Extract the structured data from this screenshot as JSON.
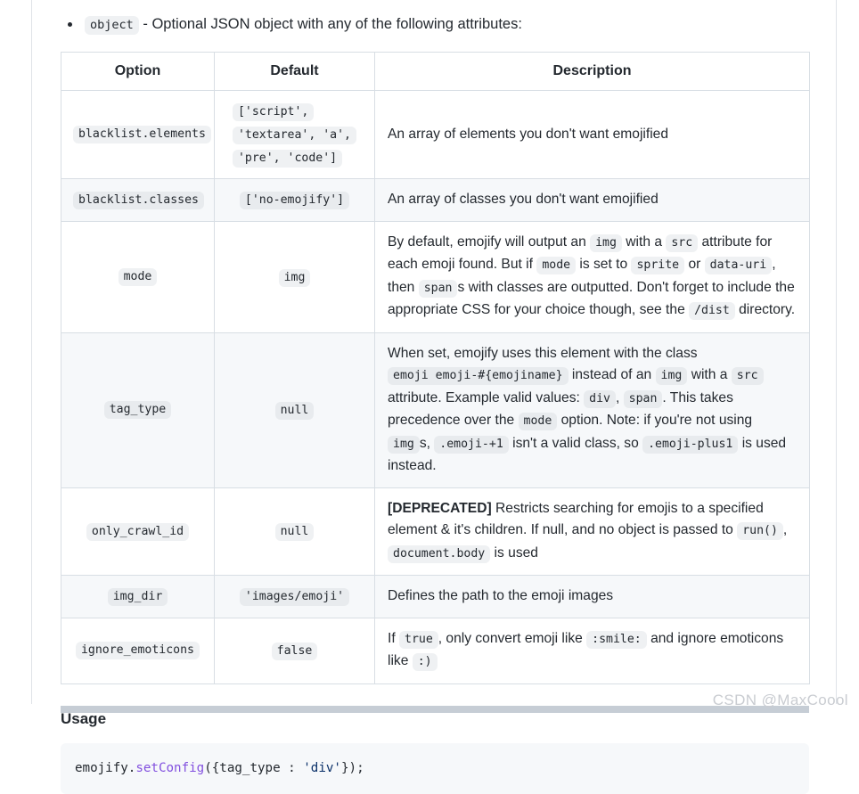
{
  "intro": {
    "code_chip": "object",
    "text": " - Optional JSON object with any of the following attributes:"
  },
  "table": {
    "headers": [
      "Option",
      "Default",
      "Description"
    ],
    "rows": [
      {
        "option": "blacklist.elements",
        "default_lines": [
          "['script',",
          "'textarea', 'a',",
          "'pre', 'code']"
        ],
        "description_parts": [
          {
            "type": "text",
            "value": "An array of elements you don't want emojified"
          }
        ]
      },
      {
        "option": "blacklist.classes",
        "default_lines": [
          "['no-emojify']"
        ],
        "description_parts": [
          {
            "type": "text",
            "value": "An array of classes you don't want emojified"
          }
        ]
      },
      {
        "option": "mode",
        "default_lines": [
          "img"
        ],
        "description_parts": [
          {
            "type": "text",
            "value": "By default, emojify will output an "
          },
          {
            "type": "code",
            "value": "img"
          },
          {
            "type": "text",
            "value": " with a "
          },
          {
            "type": "code",
            "value": "src"
          },
          {
            "type": "text",
            "value": " attribute for each emoji found. But if "
          },
          {
            "type": "code",
            "value": "mode"
          },
          {
            "type": "text",
            "value": " is set to "
          },
          {
            "type": "code",
            "value": "sprite"
          },
          {
            "type": "text",
            "value": " or "
          },
          {
            "type": "code",
            "value": "data-uri"
          },
          {
            "type": "text",
            "value": ", then "
          },
          {
            "type": "code",
            "value": "span"
          },
          {
            "type": "text",
            "value": "s with classes are outputted. Don't forget to include the appropriate CSS for your choice though, see the "
          },
          {
            "type": "code",
            "value": "/dist"
          },
          {
            "type": "text",
            "value": " directory."
          }
        ]
      },
      {
        "option": "tag_type",
        "default_lines": [
          "null"
        ],
        "description_parts": [
          {
            "type": "text",
            "value": "When set, emojify uses this element with the class "
          },
          {
            "type": "code",
            "value": "emoji emoji-#{emojiname}"
          },
          {
            "type": "text",
            "value": " instead of an "
          },
          {
            "type": "code",
            "value": "img"
          },
          {
            "type": "text",
            "value": " with a "
          },
          {
            "type": "code",
            "value": "src"
          },
          {
            "type": "text",
            "value": " attribute. Example valid values: "
          },
          {
            "type": "code",
            "value": "div"
          },
          {
            "type": "text",
            "value": ", "
          },
          {
            "type": "code",
            "value": "span"
          },
          {
            "type": "text",
            "value": ". This takes precedence over the "
          },
          {
            "type": "code",
            "value": "mode"
          },
          {
            "type": "text",
            "value": " option. Note: if you're not using "
          },
          {
            "type": "code",
            "value": "img"
          },
          {
            "type": "text",
            "value": "s, "
          },
          {
            "type": "code",
            "value": ".emoji-+1"
          },
          {
            "type": "text",
            "value": " isn't a valid class, so "
          },
          {
            "type": "code",
            "value": ".emoji-plus1"
          },
          {
            "type": "text",
            "value": " is used instead."
          }
        ]
      },
      {
        "option": "only_crawl_id",
        "default_lines": [
          "null"
        ],
        "description_parts": [
          {
            "type": "bold",
            "value": "[DEPRECATED]"
          },
          {
            "type": "text",
            "value": " Restricts searching for emojis to a specified element & it's children. If null, and no object is passed to "
          },
          {
            "type": "code",
            "value": "run()"
          },
          {
            "type": "text",
            "value": ", "
          },
          {
            "type": "code",
            "value": "document.body"
          },
          {
            "type": "text",
            "value": " is used"
          }
        ]
      },
      {
        "option": "img_dir",
        "default_lines": [
          "'images/emoji'"
        ],
        "description_parts": [
          {
            "type": "text",
            "value": "Defines the path to the emoji images"
          }
        ]
      },
      {
        "option": "ignore_emoticons",
        "default_lines": [
          "false"
        ],
        "description_parts": [
          {
            "type": "text",
            "value": "If "
          },
          {
            "type": "code",
            "value": "true"
          },
          {
            "type": "text",
            "value": ", only convert emoji like "
          },
          {
            "type": "code",
            "value": ":smile:"
          },
          {
            "type": "text",
            "value": " and ignore emoticons like "
          },
          {
            "type": "code",
            "value": ":)"
          }
        ]
      }
    ]
  },
  "usage": {
    "heading": "Usage",
    "code_tokens": [
      {
        "cls": "tok-plain",
        "value": "emojify."
      },
      {
        "cls": "tok-fn",
        "value": "setConfig"
      },
      {
        "cls": "tok-plain",
        "value": "({tag_type : "
      },
      {
        "cls": "tok-str",
        "value": "'div'"
      },
      {
        "cls": "tok-plain",
        "value": "});"
      }
    ]
  },
  "watermark": "CSDN @MaxCoool",
  "colors": {
    "page_bg": "#ffffff",
    "text": "#24292f",
    "border": "#d8dee4",
    "stripe": "#f6f8fa",
    "chip_bg": "#eff1f3",
    "code_fn": "#8250df",
    "code_str": "#0a3069",
    "scrollbar": "#c6cdd5",
    "watermark": "#c9ccd1"
  }
}
